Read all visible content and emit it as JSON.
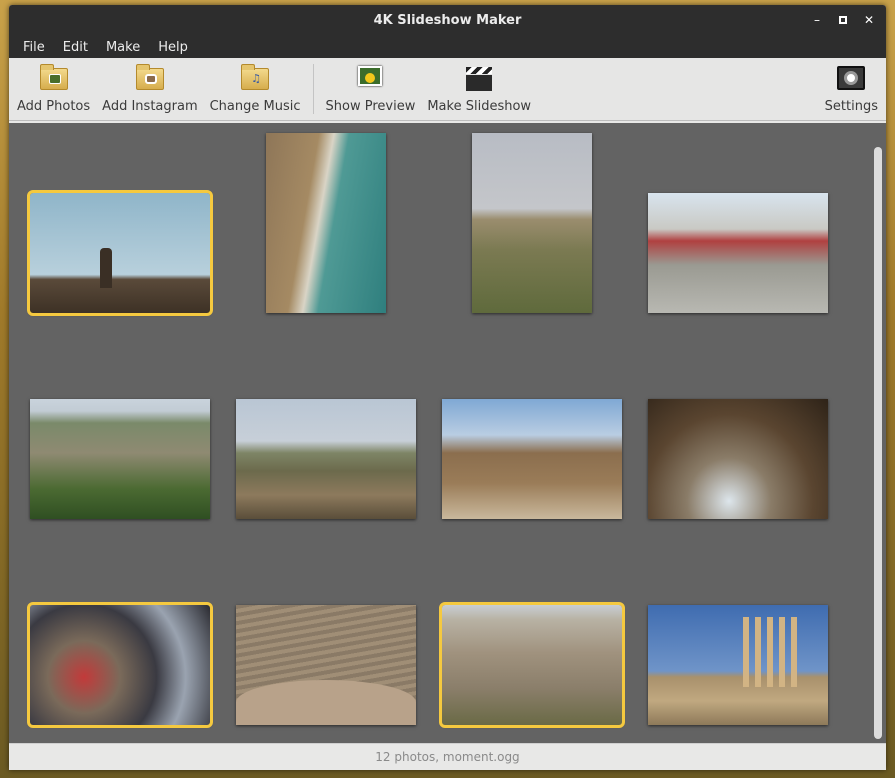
{
  "window": {
    "title": "4K Slideshow Maker",
    "minimize": "–",
    "close": "✕"
  },
  "menu": [
    "File",
    "Edit",
    "Make",
    "Help"
  ],
  "toolbar": {
    "add_photos": "Add Photos",
    "add_instagram": "Add Instagram",
    "change_music": "Change Music",
    "show_preview": "Show Preview",
    "make_slideshow": "Make Slideshow",
    "settings": "Settings"
  },
  "photos": [
    {
      "name": "photo-rock-formation",
      "selected": true
    },
    {
      "name": "photo-dead-sea-coast",
      "selected": false
    },
    {
      "name": "photo-hill-ruin",
      "selected": false
    },
    {
      "name": "photo-street-scene",
      "selected": false
    },
    {
      "name": "photo-valley-village",
      "selected": false
    },
    {
      "name": "photo-castle-hill-view",
      "selected": false
    },
    {
      "name": "photo-castle",
      "selected": false
    },
    {
      "name": "photo-stone-vault",
      "selected": false
    },
    {
      "name": "photo-market-bracelets",
      "selected": true
    },
    {
      "name": "photo-roman-theatre",
      "selected": false
    },
    {
      "name": "photo-city-view",
      "selected": true
    },
    {
      "name": "photo-temple-columns",
      "selected": false
    }
  ],
  "status": "12 photos, moment.ogg",
  "colors": {
    "selection": "#f5c93f",
    "gallery_bg": "#636363",
    "titlebar": "#2d2d2d"
  }
}
